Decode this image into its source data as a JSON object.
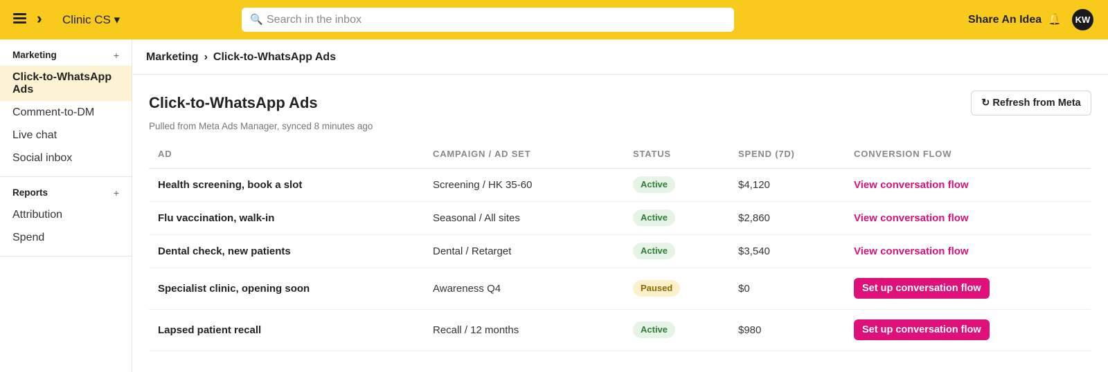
{
  "header": {
    "workspace": "Clinic CS ▾",
    "search_placeholder": "Search in the inbox",
    "share_idea": "Share An Idea",
    "avatar_initials": "KW",
    "accent_color": "#f7ca1c"
  },
  "sidebar": {
    "sections": [
      {
        "title": "Marketing",
        "items": [
          "Click-to-WhatsApp Ads",
          "Comment-to-DM",
          "Live chat",
          "Social inbox"
        ],
        "active_index": 0
      },
      {
        "title": "Reports",
        "items": [
          "Attribution",
          "Spend"
        ]
      }
    ],
    "plus": "+"
  },
  "breadcrumb": {
    "parent": "Marketing",
    "separator": "›",
    "current": "Click-to-WhatsApp Ads"
  },
  "page": {
    "title": "Click-to-WhatsApp Ads",
    "subtitle": "Pulled from Meta Ads Manager, synced 8 minutes ago",
    "refresh_label": "Refresh from Meta"
  },
  "table": {
    "columns": [
      "AD",
      "CAMPAIGN / AD SET",
      "STATUS",
      "SPEND (7D)",
      "CONVERSION FLOW"
    ],
    "rows": [
      {
        "ad": "Health screening, book a slot",
        "campaign": "Screening / HK 35-60",
        "status": "Active",
        "spend": "$4,120",
        "flow": "View conversation flow"
      },
      {
        "ad": "Flu vaccination, walk-in",
        "campaign": "Seasonal / All sites",
        "status": "Active",
        "spend": "$2,860",
        "flow": "View conversation flow"
      },
      {
        "ad": "Dental check, new patients",
        "campaign": "Dental / Retarget",
        "status": "Active",
        "spend": "$3,540",
        "flow": "View conversation flow"
      },
      {
        "ad": "Specialist clinic, opening soon",
        "campaign": "Awareness Q4",
        "status": "Paused",
        "spend": "$0",
        "flow": "Set up conversation flow"
      },
      {
        "ad": "Lapsed patient recall",
        "campaign": "Recall / 12 months",
        "status": "Active",
        "spend": "$980",
        "flow": "Set up conversation flow"
      }
    ]
  },
  "colors": {
    "link": "#d6127a",
    "primary_button": "#e0107a",
    "active_badge": "#2e7d32",
    "paused_badge": "#8a6a00"
  }
}
